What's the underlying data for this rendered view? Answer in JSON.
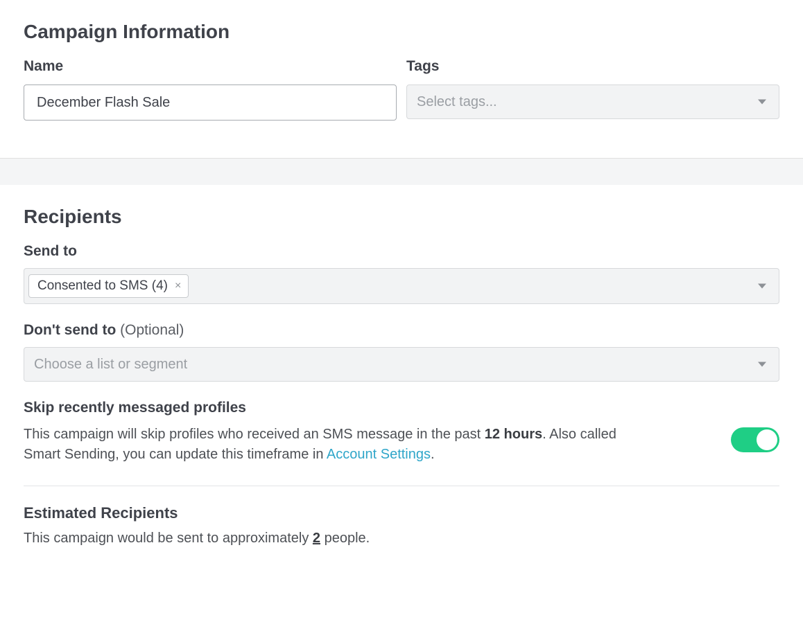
{
  "campaign_info": {
    "heading": "Campaign Information",
    "name_label": "Name",
    "name_value": "December Flash Sale",
    "tags_label": "Tags",
    "tags_placeholder": "Select tags..."
  },
  "recipients": {
    "heading": "Recipients",
    "send_to_label": "Send to",
    "send_to_chip": "Consented to SMS (4)",
    "dont_send_label": "Don't send to",
    "dont_send_optional": "(Optional)",
    "dont_send_placeholder": "Choose a list or segment",
    "skip_heading": "Skip recently messaged profiles",
    "skip_text_pre": "This campaign will skip profiles who received an SMS message in the past ",
    "skip_timeframe": "12 hours",
    "skip_text_mid": ". Also called Smart Sending, you can update this timeframe in ",
    "skip_link": "Account Settings",
    "skip_text_post": ".",
    "estimated_heading": "Estimated Recipients",
    "estimated_pre": "This campaign would be sent to approximately ",
    "estimated_count": "2",
    "estimated_post": " people."
  }
}
